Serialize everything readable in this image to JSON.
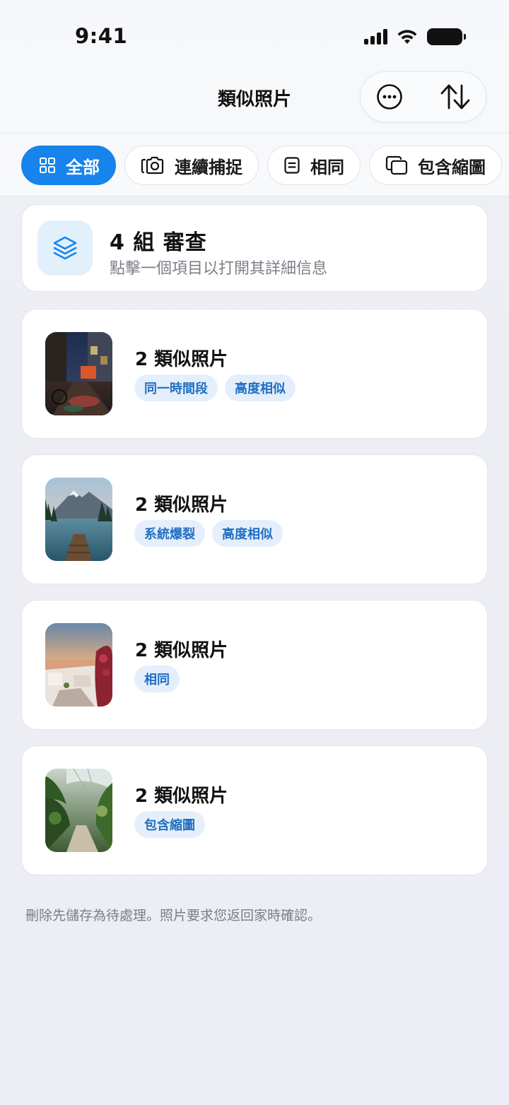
{
  "status_bar": {
    "time": "9:41"
  },
  "header": {
    "title": "類似照片"
  },
  "filters": [
    {
      "label": "全部",
      "icon": "grid-icon",
      "active": true
    },
    {
      "label": "連續捕捉",
      "icon": "camera-burst-icon",
      "active": false
    },
    {
      "label": "相同",
      "icon": "document-icon",
      "active": false
    },
    {
      "label": "包含縮圖",
      "icon": "overlap-squares-icon",
      "active": false
    }
  ],
  "summary": {
    "title": "4 組 審查",
    "subtitle": "點擊一個項目以打開其詳細信息"
  },
  "groups": [
    {
      "title": "2 類似照片",
      "tags": [
        "同一時間段",
        "高度相似"
      ]
    },
    {
      "title": "2 類似照片",
      "tags": [
        "系統爆裂",
        "高度相似"
      ]
    },
    {
      "title": "2 類似照片",
      "tags": [
        "相同"
      ]
    },
    {
      "title": "2 類似照片",
      "tags": [
        "包含縮圖"
      ]
    }
  ],
  "footer": {
    "note": "刪除先儲存為待處理。照片要求您返回家時確認。"
  },
  "colors": {
    "accent": "#1684ec",
    "tag_bg": "#e4effb",
    "tag_text": "#1f6fc4"
  }
}
